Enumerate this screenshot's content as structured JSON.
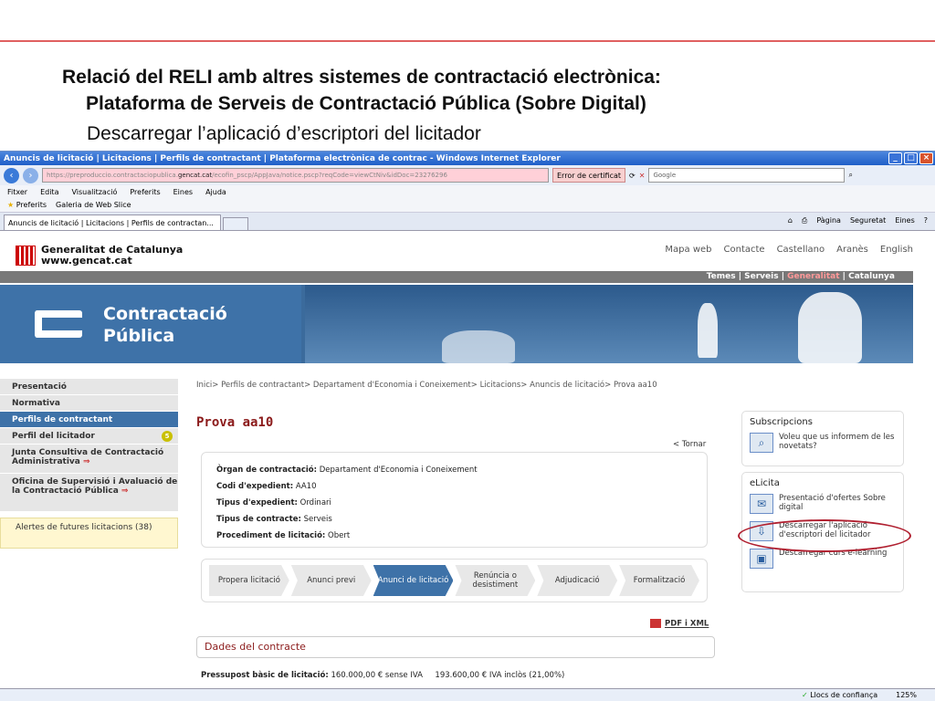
{
  "slide": {
    "title_line1": "Relació del RELI amb altres sistemes de contractació electrònica:",
    "title_line2": "Plataforma de Serveis de Contractació Pública (Sobre Digital)",
    "subtitle": "Descarregar l’aplicació d’escriptori del licitador"
  },
  "browser": {
    "window_title": "Anuncis de licitació | Licitacions | Perfils de contractant | Plataforma electrònica de contrac - Windows Internet Explorer",
    "url_prefix": "https://preproduccio.contractaciopublica.",
    "url_domain": "gencat.cat",
    "url_suffix": "/ecofin_pscp/AppJava/notice.pscp?reqCode=viewCtNiv&idDoc=23276296",
    "cert_error": "Error de certificat",
    "search_placeholder": "Google",
    "menu": [
      "Fitxer",
      "Edita",
      "Visualització",
      "Preferits",
      "Eines",
      "Ajuda"
    ],
    "fav_label": "Preferits",
    "fav_gallery": "Galeria de Web Slice",
    "tab_label": "Anuncis de licitació | Licitacions | Perfils de contractan...",
    "tools": [
      "Pàgina",
      "Seguretat",
      "Eines"
    ],
    "status_trust": "Llocs de confiança",
    "zoom": "125%"
  },
  "site": {
    "logo_line1": "Generalitat de Catalunya",
    "logo_line2": "www.gencat.cat",
    "toplinks": [
      "Mapa web",
      "Contacte",
      "Castellano",
      "Aranès",
      "English"
    ],
    "bar_temes": "Temes",
    "bar_serveis": "Serveis",
    "bar_generalitat": "Generalitat",
    "bar_catalunya": "Catalunya",
    "banner_line1": "Contractació",
    "banner_line2": "Pública"
  },
  "sidebar": {
    "items": [
      "Presentació",
      "Normativa",
      "Perfils de contractant"
    ],
    "perfil": "Perfil del licitador",
    "perfil_badge": "5",
    "junta": "Junta Consultiva de Contractació Administrativa",
    "oficina": "Oficina de Supervisió i Avaluació de la Contractació Pública",
    "alerts": "Alertes de futures licitacions (38)"
  },
  "main": {
    "breadcrumb": "Inici> Perfils de contractant> Departament d'Economia i Coneixement> Licitacions> Anuncis de licitació> Prova aa10",
    "title": "Prova aa10",
    "back": "< Tornar",
    "info": [
      {
        "label": "Òrgan de contractació:",
        "value": "Departament d'Economia i Coneixement"
      },
      {
        "label": "Codi d'expedient:",
        "value": "AA10"
      },
      {
        "label": "Tipus d'expedient:",
        "value": "Ordinari"
      },
      {
        "label": "Tipus de contracte:",
        "value": "Serveis"
      },
      {
        "label": "Procediment de licitació:",
        "value": "Obert"
      }
    ],
    "steps": [
      "Propera licitació",
      "Anunci previ",
      "Anunci de licitació",
      "Renúncia o desistiment",
      "Adjudicació",
      "Formalització"
    ],
    "pdf": "PDF i XML",
    "dades": "Dades del contracte",
    "pres_label": "Pressupost bàsic de licitació:",
    "pres_value": "160.000,00 € sense IVA     193.600,00 € IVA inclòs (21,00%)"
  },
  "right": {
    "subs_title": "Subscripcions",
    "subs_item": "Voleu que us informem de les novetats?",
    "elicita_title": "eLicita",
    "items": [
      "Presentació d'ofertes Sobre digital",
      "Descarregar l'aplicació d'escriptori del licitador",
      "Descarregar curs e-learning"
    ]
  }
}
